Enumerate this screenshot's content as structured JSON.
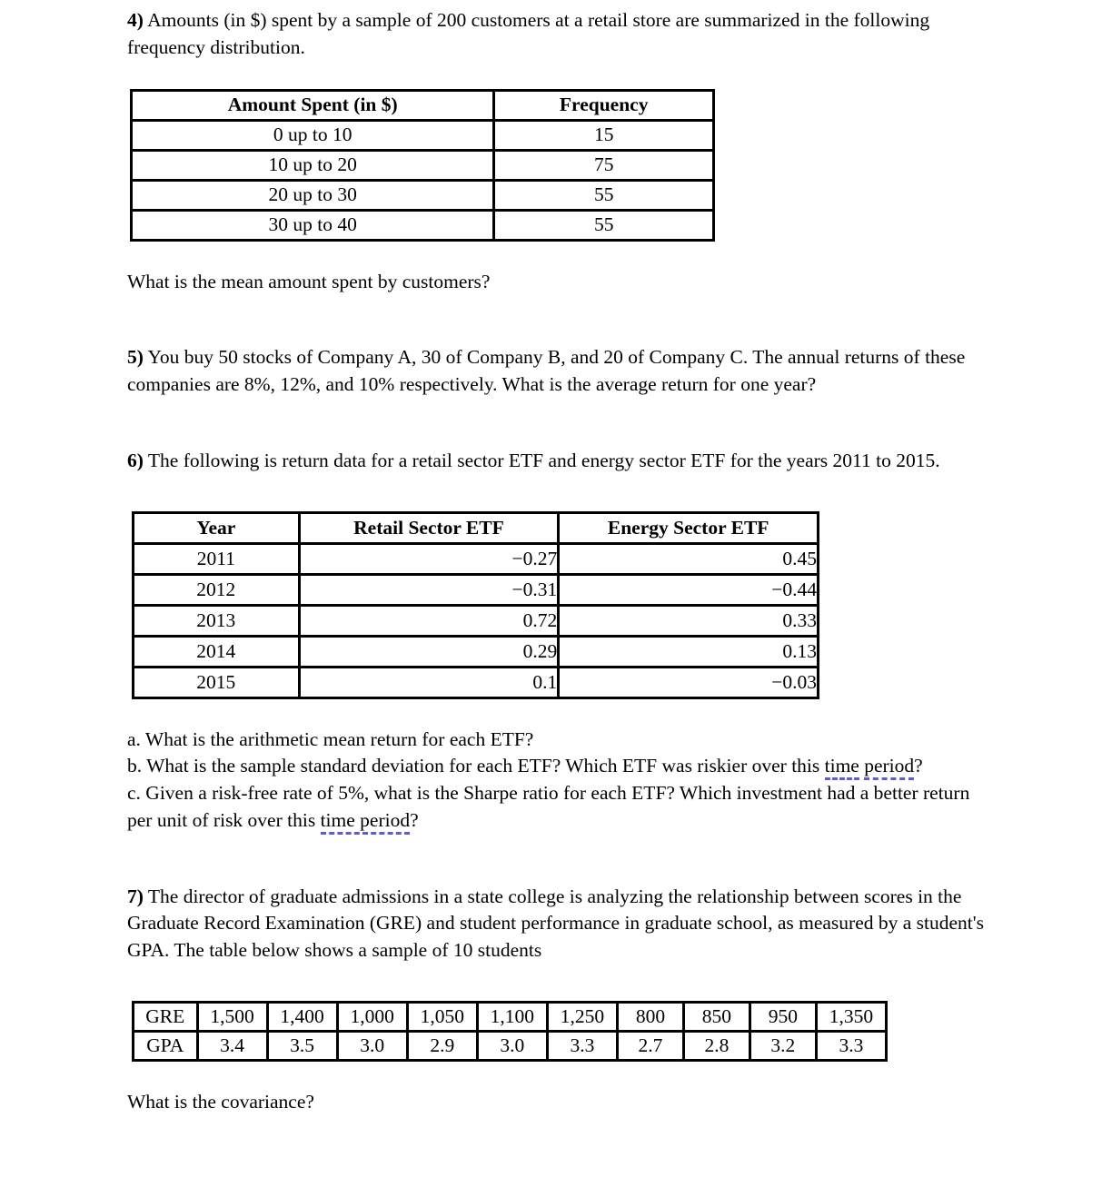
{
  "document": {
    "questions": [
      {
        "id": "q4",
        "number": "4)",
        "text": " Amounts (in $) spent by a sample of 200 customers at a retail store are summarized in the following frequency distribution.",
        "prompt": "What is the mean amount spent by customers?"
      },
      {
        "id": "q5",
        "number": "5)",
        "text": " You buy 50 stocks of Company A, 30 of Company B, and 20 of Company C. The annual returns of these companies are 8%, 12%, and 10% respectively. What is the average return for one year?"
      },
      {
        "id": "q6",
        "number": "6)",
        "text": " The following is return data for a retail sector ETF and energy sector ETF for the years 2011 to 2015.",
        "subquestions": {
          "a": "a. What is the arithmetic mean return for each ETF?",
          "b_part1": "b. What is the sample standard deviation for each ETF? Which ETF was riskier over this ",
          "b_flag1": "time",
          "b_part2": " ",
          "b_flag2": "period",
          "b_part3": "?",
          "c_part1": "c. Given a risk-free rate of 5%, what is the Sharpe ratio for each ETF? Which investment had a better return per unit of risk over this ",
          "c_flag": "time period",
          "c_part2": "?"
        }
      },
      {
        "id": "q7",
        "number": "7)",
        "text": " The director of graduate admissions in a state college is analyzing the relationship between scores in the Graduate Record Examination (GRE) and student performance in graduate school, as measured by a student's GPA. The table below shows a sample of 10 students",
        "prompt": "What is the covariance?"
      }
    ],
    "amount_table": {
      "headers": [
        "Amount Spent (in $)",
        "Frequency"
      ],
      "rows": [
        [
          "0 up to 10",
          "15"
        ],
        [
          "10 up to 20",
          "75"
        ],
        [
          "20 up to 30",
          "55"
        ],
        [
          "30 up to 40",
          "55"
        ]
      ]
    },
    "etf_table": {
      "headers": [
        "Year",
        "Retail Sector ETF",
        "Energy Sector ETF"
      ],
      "rows": [
        [
          "2011",
          "−0.27",
          "0.45"
        ],
        [
          "2012",
          "−0.31",
          "−0.44"
        ],
        [
          "2013",
          "0.72",
          "0.33"
        ],
        [
          "2014",
          "0.29",
          "0.13"
        ],
        [
          "2015",
          "0.1",
          "−0.03"
        ]
      ]
    },
    "gre_table": {
      "row_labels": [
        "GRE",
        "GPA"
      ],
      "gre_values": [
        "1,500",
        "1,400",
        "1,000",
        "1,050",
        "1,100",
        "1,250",
        "800",
        "850",
        "950",
        "1,350"
      ],
      "gpa_values": [
        "3.4",
        "3.5",
        "3.0",
        "2.9",
        "3.0",
        "3.3",
        "2.7",
        "2.8",
        "3.2",
        "3.3"
      ]
    },
    "colors": {
      "text": "#000000",
      "background": "#ffffff",
      "rule": "#000000",
      "grammar_underline": "#5b5bd6"
    }
  }
}
